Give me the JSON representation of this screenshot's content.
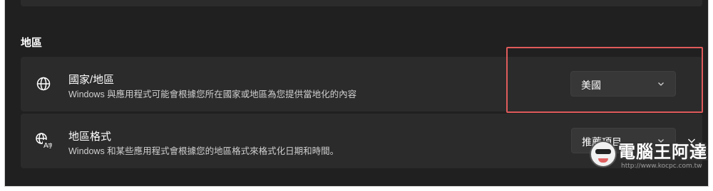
{
  "section": {
    "title": "地區"
  },
  "rows": [
    {
      "icon": "globe-icon",
      "title": "國家/地區",
      "description": "Windows 與應用程式可能會根據您所在國家或地區為您提供當地化的內容",
      "dropdown_value": "美國"
    },
    {
      "icon": "language-format-icon",
      "title": "地區格式",
      "description": "Windows 和某些應用程式會根據您的地區格式來格式化日期和時間。",
      "dropdown_value": "推薦項目"
    }
  ],
  "annotation": {
    "highlight_color": "#e05a5a"
  },
  "watermark": {
    "title": "電腦王阿達",
    "url": "http://www.kocpc.com.tw"
  },
  "colors": {
    "background": "#202020",
    "card": "#2b2b2b",
    "dropdown": "#373737",
    "text": "#ffffff"
  }
}
